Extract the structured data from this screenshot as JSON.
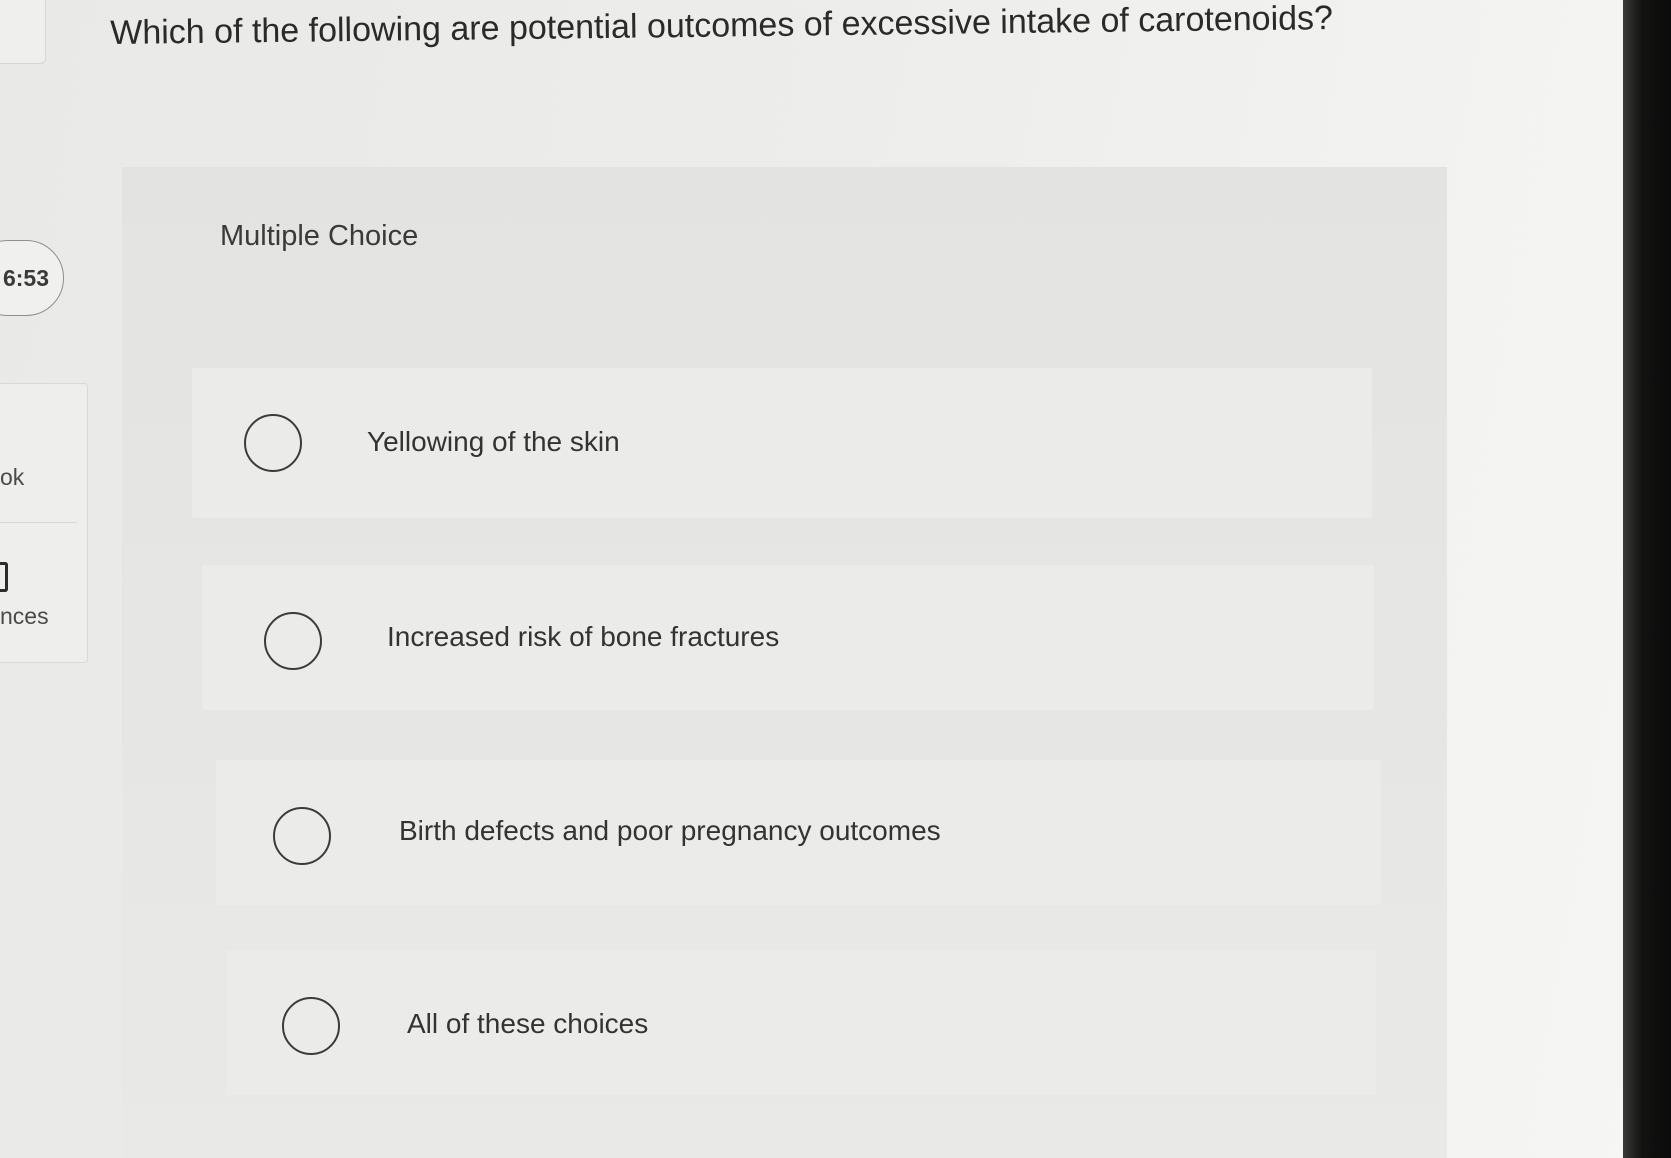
{
  "question": {
    "text": "Which of the following are potential outcomes of excessive intake of carotenoids?"
  },
  "sidebar": {
    "timer": "6:53",
    "ebook_label": "ok",
    "references_label": "nces"
  },
  "quiz": {
    "type_label": "Multiple Choice",
    "options": [
      {
        "label": "Yellowing of the skin"
      },
      {
        "label": "Increased risk of bone fractures"
      },
      {
        "label": "Birth defects and poor pregnancy outcomes"
      },
      {
        "label": "All of these choices"
      }
    ]
  },
  "colors": {
    "bezel": "#0b0b0b",
    "panel": "#e6e6e4",
    "text": "#2f2f2f"
  }
}
